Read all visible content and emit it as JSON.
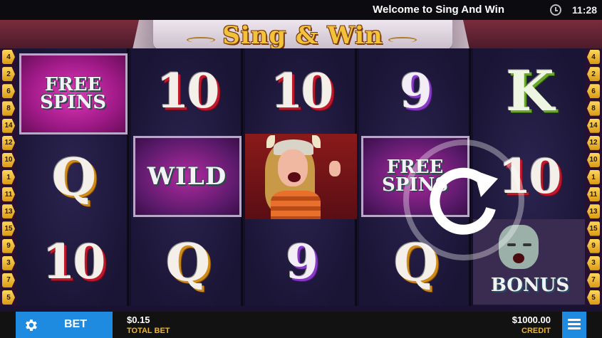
{
  "status_bar": {
    "title": "Welcome to Sing And Win",
    "time": "11:28"
  },
  "logo": {
    "text": "Sing & Win"
  },
  "paylines": {
    "left": [
      "4",
      "2",
      "6",
      "8",
      "14",
      "12",
      "10",
      "1",
      "11",
      "13",
      "15",
      "9",
      "3",
      "7",
      "5"
    ],
    "right": [
      "4",
      "2",
      "6",
      "8",
      "14",
      "12",
      "10",
      "1",
      "11",
      "13",
      "15",
      "9",
      "3",
      "7",
      "5"
    ]
  },
  "reels": [
    [
      "FREE SPINS",
      "Q",
      "10"
    ],
    [
      "10",
      "WILD",
      "Q"
    ],
    [
      "10",
      "singer",
      "9"
    ],
    [
      "9",
      "FREE SPINS",
      "Q"
    ],
    [
      "K",
      "10",
      "BONUS"
    ]
  ],
  "symbols": {
    "free_spins": "FREE SPINS",
    "wild": "WILD",
    "bonus": "BONUS",
    "q": "Q",
    "k": "K",
    "ten": "10",
    "nine": "9"
  },
  "colors": {
    "button_blue": "#1e8ae0",
    "label_gold": "#f0b428",
    "ten_red": "#c0182c",
    "nine_purple": "#8a3ac8",
    "k_green": "#6aa82a"
  },
  "bottom_bar": {
    "bet_label": "BET",
    "total_bet_value": "$0.15",
    "total_bet_label": "TOTAL BET",
    "credit_value": "$1000.00",
    "credit_label": "CREDIT"
  },
  "icons": [
    "clock-icon",
    "gear-icon",
    "spin-icon",
    "menu-icon"
  ]
}
